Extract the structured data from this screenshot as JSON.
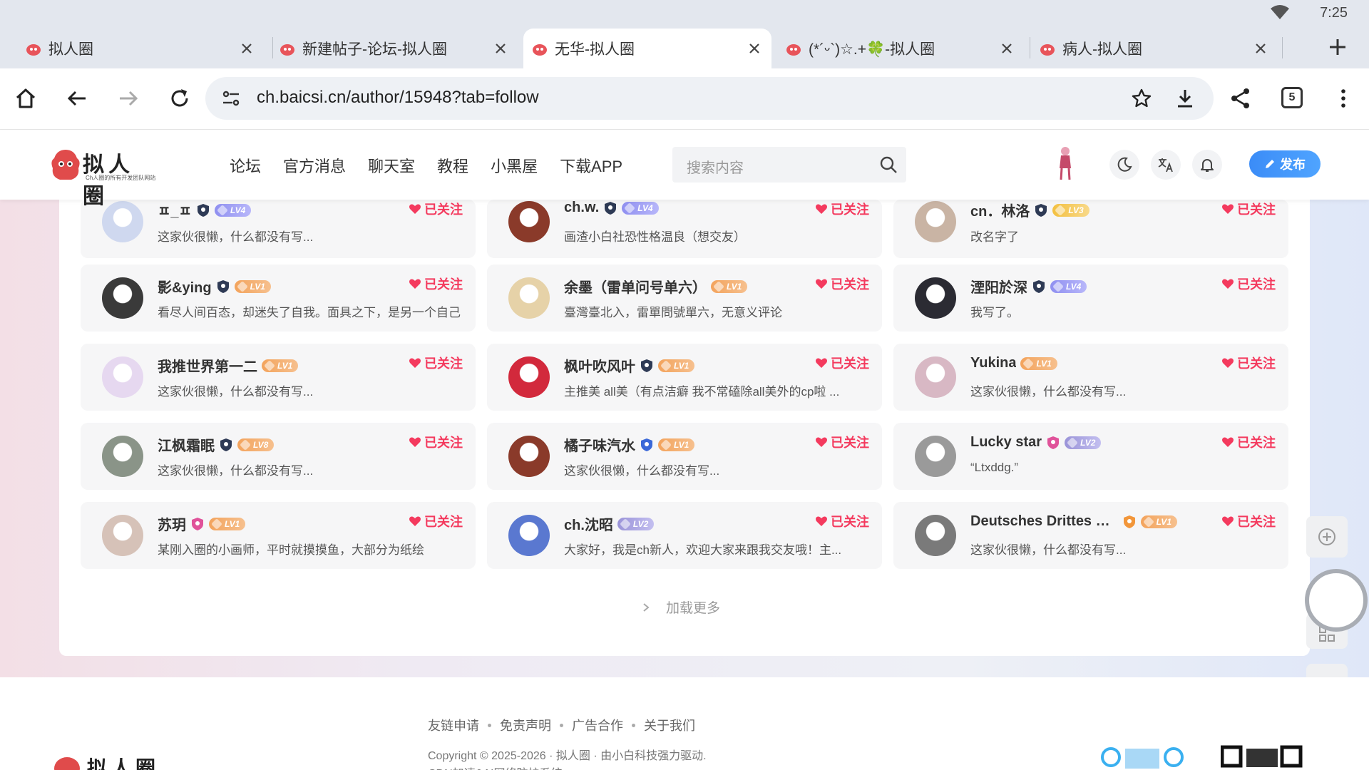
{
  "status": {
    "time": "7:25"
  },
  "tabs": [
    {
      "title": "拟人圈",
      "active": false
    },
    {
      "title": "新建帖子-论坛-拟人圈",
      "active": false
    },
    {
      "title": "无华-拟人圈",
      "active": true
    },
    {
      "title": "(*´ᵕ`)☆.+🍀-拟人圈",
      "active": false
    },
    {
      "title": "病人-拟人圈",
      "active": false
    }
  ],
  "toolbar": {
    "url": "ch.baicsi.cn/author/15948?tab=follow",
    "tab_count": "5"
  },
  "site": {
    "logo_text": "拟人圈",
    "logo_sub": "Ch人圈的所有开发团队网站",
    "nav": [
      "论坛",
      "官方消息",
      "聊天室",
      "教程",
      "小黑屋",
      "下载APP"
    ],
    "search_placeholder": "搜索内容",
    "publish_label": "发布",
    "accent": "#3b8cf7"
  },
  "follow_label": "已关注",
  "users": [
    {
      "name": "ㅍ_ㅍ",
      "lv": "LV4",
      "lv_color": "purple",
      "verify": "outline",
      "bio": "这家伙很懒，什么都没有写..."
    },
    {
      "name": "ch.w.",
      "lv": "LV4",
      "lv_color": "purple",
      "verify": "outline",
      "bio": "画渣小白社恐性格温良（想交友）"
    },
    {
      "name": "cn．林洛",
      "lv": "LV3",
      "lv_color": "gold",
      "verify": "outline",
      "bio": "改名字了"
    },
    {
      "name": "影&ying",
      "lv": "LV1",
      "lv_color": "orange",
      "verify": "person",
      "bio": "看尽人间百态，却迷失了自我。面具之下，是另一个自己"
    },
    {
      "name": "余墨（雷单问号单六）",
      "lv": "LV1",
      "lv_color": "orange",
      "verify": "none",
      "bio": "臺灣臺北入，雷單問號單六，无意义评论"
    },
    {
      "name": "湮阳於深",
      "lv": "LV4",
      "lv_color": "purple",
      "verify": "outline",
      "bio": "我写了。"
    },
    {
      "name": "我推世界第一二",
      "lv": "LV1",
      "lv_color": "orange",
      "verify": "none",
      "bio": "这家伙很懒，什么都没有写..."
    },
    {
      "name": "枫叶吹风叶",
      "lv": "LV1",
      "lv_color": "orange",
      "verify": "person",
      "bio": "主推美 all美（有点洁癖 我不常磕除all美外的cp啦 ..."
    },
    {
      "name": "Yukina",
      "lv": "LV1",
      "lv_color": "orange",
      "verify": "none",
      "bio": "这家伙很懒，什么都没有写..."
    },
    {
      "name": "江枫霜眠",
      "lv": "LV8",
      "lv_color": "orange",
      "verify": "outline",
      "bio": "这家伙很懒，什么都没有写..."
    },
    {
      "name": "橘子味汽水",
      "lv": "LV1",
      "lv_color": "orange",
      "verify": "person-blue",
      "bio": "这家伙很懒，什么都没有写..."
    },
    {
      "name": "Lucky star",
      "lv": "LV2",
      "lv_color": "violet",
      "verify": "female",
      "bio": "“Ltxddg.”"
    },
    {
      "name": "苏玥",
      "lv": "LV1",
      "lv_color": "orange",
      "verify": "female",
      "bio": "某刚入圈的小画师，平时就摸摸鱼，大部分为纸绘"
    },
    {
      "name": "ch.沈昭",
      "lv": "LV2",
      "lv_color": "violet",
      "verify": "none",
      "bio": "大家好，我是ch新人，欢迎大家来跟我交友哦！主..."
    },
    {
      "name": "Deutsches Drittes ReiDe...",
      "lv": "LV1",
      "lv_color": "orange",
      "verify": "medal",
      "bio": "这家伙很懒，什么都没有写..."
    }
  ],
  "load_more": "加载更多",
  "footer": {
    "links": [
      "友链申请",
      "免责声明",
      "广告合作",
      "关于我们"
    ],
    "copyright": "Copyright © 2025-2026 · 拟人圈 · 由小白科技强力驱动.",
    "cdn": "CDN加速&AI网络防护系统",
    "logo_text": "拟人圈"
  }
}
